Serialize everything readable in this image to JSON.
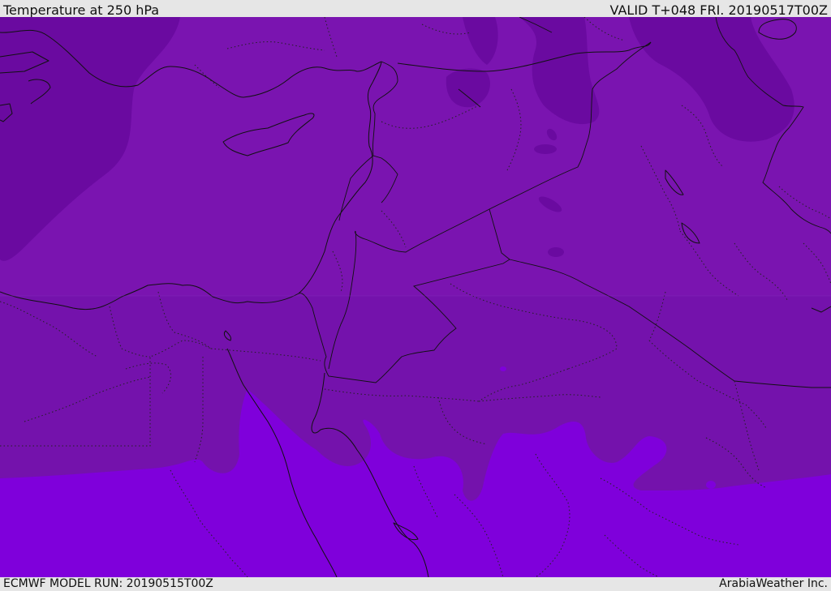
{
  "header": {
    "title": "Temperature at 250 hPa",
    "valid": "VALID T+048 FRI. 20190517T00Z"
  },
  "footer": {
    "model_run": "ECMWF MODEL RUN: 20190515T00Z",
    "credit": "ArabiaWeather Inc."
  },
  "map": {
    "field": "temperature-250hPa",
    "shading_colors": {
      "coldest": "#6a0aa0",
      "cold": "#7a14b0",
      "mid": "#7412ac",
      "warm": "#7f00db"
    }
  }
}
